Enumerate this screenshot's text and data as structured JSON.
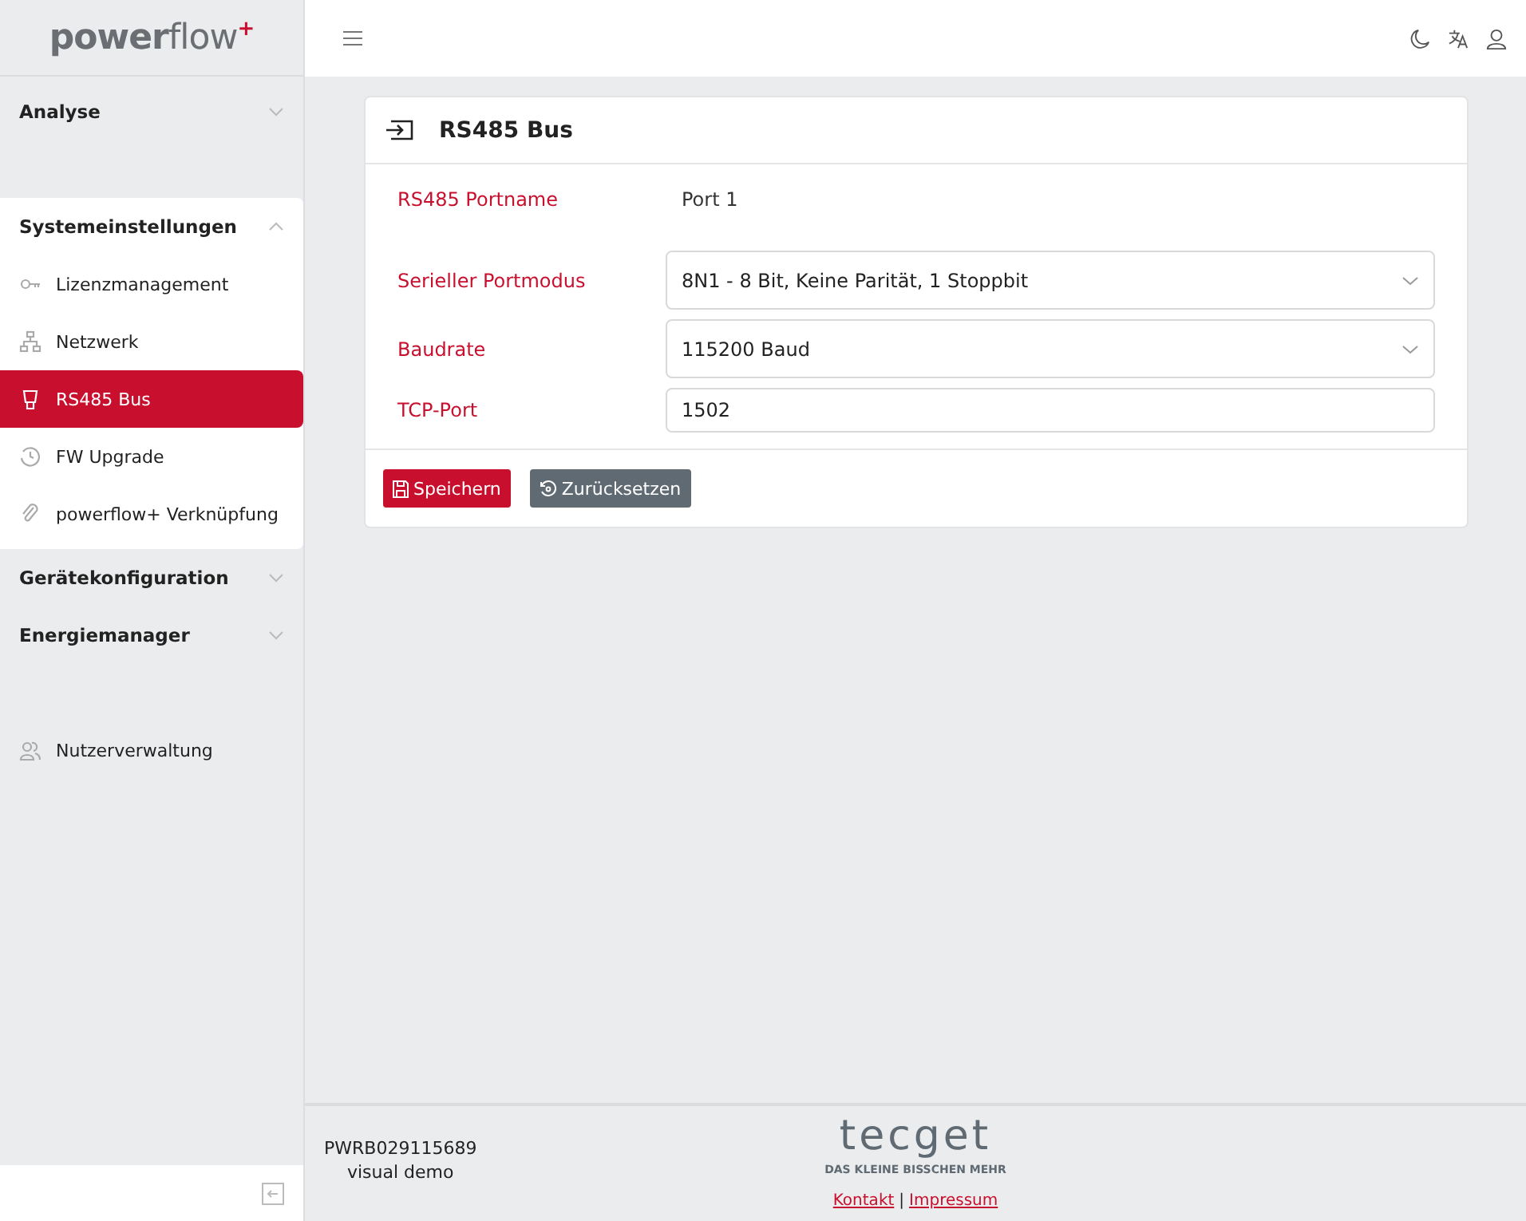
{
  "logo": "**power**flow$^{+}$",
  "sidebar": {
    "groups": [
      {
        "label": "Analyse",
        "expanded": false
      },
      {
        "label": "Systemeinstellungen",
        "expanded": true,
        "items": [
          {
            "label": "Lizenzmanagement",
            "selected": false
          },
          {
            "label": "Netzwerk",
            "selected": false
          },
          {
            "label": "RS485 Bus",
            "selected": true
          },
          {
            "label": "FW Upgrade",
            "selected": false
          },
          {
            "label": "powerflow+ Verknüpfung",
            "selected": false
          }
        ]
      },
      {
        "label": "Gerätekonfiguration",
        "expanded": false
      },
      {
        "label": "Energiemanager",
        "expanded": false
      }
    ],
    "bottom_items": [
      {
        "label": "Nutzerverwaltung",
        "selected": false
      }
    ]
  },
  "card": {
    "title": "RS485 Bus",
    "fields": [
      {
        "kind": "static",
        "label": "RS485 Portname",
        "value": "Port 1"
      },
      {
        "kind": "select",
        "label": "Serieller Portmodus",
        "value": "8N1 - 8 Bit, Keine Parität, 1 Stoppbit"
      },
      {
        "kind": "select",
        "label": "Baudrate",
        "value": "115200 Baud"
      },
      {
        "kind": "input",
        "label": "TCP-Port",
        "value": "1502"
      }
    ],
    "buttons": [
      {
        "label": "Speichern",
        "kind": "save"
      },
      {
        "label": "Zurücksetzen",
        "kind": "reset"
      }
    ]
  },
  "footer": {
    "serial": "PWRB029115689",
    "mode": "visual demo",
    "brand": "tecget",
    "tagline": "DAS KLEINE BISSCHEN MEHR",
    "links": [
      "Kontakt",
      "Impressum"
    ],
    "separator": "|"
  }
}
